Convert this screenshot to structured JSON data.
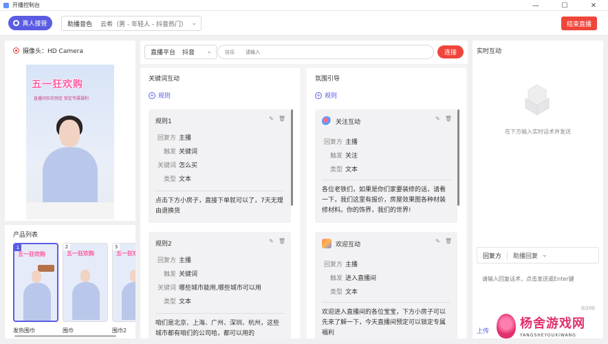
{
  "window": {
    "title": "开播控制台",
    "controls": [
      "—",
      "☐",
      "✕"
    ]
  },
  "toolbar": {
    "host_button": "真人接管",
    "voice_label": "助播音色",
    "voice_value": "云希（男 - 年轻人 - 抖音热门）",
    "end_button": "结束直播"
  },
  "camera": {
    "label": "摄像头：HD Camera",
    "banner": "五一狂欢购",
    "banner_sub": "直播间狂欢预定  锁定专属福利"
  },
  "products": {
    "title": "产品列表",
    "items": [
      {
        "index": "1",
        "label": "发热围巾",
        "banner": "五一狂欢购"
      },
      {
        "index": "2",
        "label": "围巾",
        "banner": "五一狂欢购"
      },
      {
        "index": "3",
        "label": "围巾2",
        "banner": "五一狂欢"
      }
    ]
  },
  "connect": {
    "platform_label": "直播平台",
    "platform_value": "抖音",
    "link_label": "链接",
    "link_placeholder": "请输入",
    "connect_button": "连接"
  },
  "keyword_col": {
    "title": "关键词互动",
    "add_rule": "规则",
    "rules": [
      {
        "name": "规则1",
        "rows": [
          {
            "k": "回复方",
            "v": "主播"
          },
          {
            "k": "触发",
            "v": "关键词"
          },
          {
            "k": "关键词",
            "v": "怎么买"
          },
          {
            "k": "类型",
            "v": "文本"
          }
        ],
        "body": "点击下方小房子，直接下单就可以了，7天无理由退换货"
      },
      {
        "name": "规则2",
        "rows": [
          {
            "k": "回复方",
            "v": "主播"
          },
          {
            "k": "触发",
            "v": "关键词"
          },
          {
            "k": "关键词",
            "v": "哪些城市能用,哪些城市可以用"
          },
          {
            "k": "类型",
            "v": "文本"
          }
        ],
        "body": "咱们是北京、上海、广州、深圳、杭州，这些城市都有咱们的公司哈，都可以用的"
      }
    ]
  },
  "atmosphere_col": {
    "title": "氛围引导",
    "add_rule": "规则",
    "rules": [
      {
        "name": "关注互动",
        "icon": "follow-icon",
        "rows": [
          {
            "k": "回复方",
            "v": "主播"
          },
          {
            "k": "触发",
            "v": "关注"
          },
          {
            "k": "类型",
            "v": "文本"
          }
        ],
        "body": "各位老铁们，如果是你们家要装修的话，请看一下，我们这里有报价，房屋效果图各种材装修材料。你的饰界，我们的世界!"
      },
      {
        "name": "欢迎互动",
        "icon": "welcome-icon",
        "rows": [
          {
            "k": "回复方",
            "v": "主播"
          },
          {
            "k": "触发",
            "v": "进入直播间"
          },
          {
            "k": "类型",
            "v": "文本"
          }
        ],
        "body": "欢迎进入直播间的各位宝宝，下方小房子可以先来了解一下，今天直播间预定可以锁定专属福利"
      }
    ]
  },
  "realtime": {
    "title": "实时互动",
    "empty_text": "在下方输入实时话术并发送",
    "reply_label": "回复方",
    "reply_value": "助播回复",
    "input_placeholder": "请输入回复话术，点击发送或Enter键",
    "counter": "0/200",
    "send_link": "上传"
  },
  "watermark": {
    "text": "杨舍游戏网",
    "sub": "YANGSHEYOUXIWANG"
  },
  "colors": {
    "primary": "#5b5ce2",
    "danger": "#f0453a",
    "watermark": "#e0306e"
  }
}
